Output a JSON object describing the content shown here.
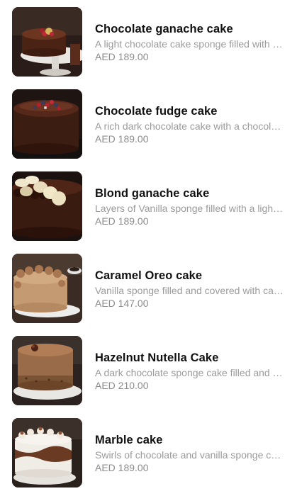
{
  "items": [
    {
      "name": "Chocolate ganache cake",
      "description": "A light chocolate cake sponge filled with chocolate ganache",
      "price": "AED 189.00",
      "image": "chocolate-ganache-cake-image"
    },
    {
      "name": "Chocolate fudge cake",
      "description": "A rich dark chocolate cake with a chocolate fudge",
      "price": "AED 189.00",
      "image": "chocolate-fudge-cake-image"
    },
    {
      "name": "Blond ganache cake",
      "description": "Layers of Vanilla sponge filled with a light ganache",
      "price": "AED 189.00",
      "image": "blond-ganache-cake-image"
    },
    {
      "name": "Caramel Oreo cake",
      "description": "Vanilla sponge filled and covered with caramel",
      "price": "AED 147.00",
      "image": "caramel-oreo-cake-image"
    },
    {
      "name": "Hazelnut Nutella Cake",
      "description": "A dark chocolate sponge cake filled and covered",
      "price": "AED 210.00",
      "image": "hazelnut-nutella-cake-image"
    },
    {
      "name": "Marble cake",
      "description": "Swirls of chocolate and vanilla sponge cake",
      "price": "AED 189.00",
      "image": "marble-cake-image"
    }
  ]
}
